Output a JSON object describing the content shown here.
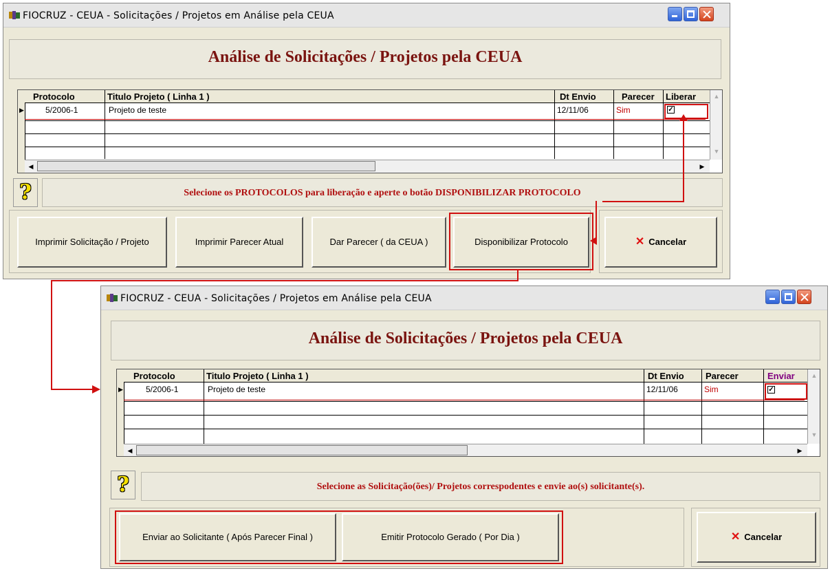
{
  "window_top": {
    "title": "FIOCRUZ - CEUA - Solicitações / Projetos em Análise pela CEUA",
    "heading": "Análise de Solicitações / Projetos pela CEUA",
    "columns": [
      "Protocolo",
      "Titulo Projeto ( Linha 1 )",
      "Dt Envio",
      "Parecer",
      "Liberar"
    ],
    "row": {
      "protocolo": "5/2006-1",
      "titulo": "Projeto de teste",
      "dt_envio": "12/11/06",
      "parecer": "Sim",
      "checked": true
    },
    "message": "Selecione os PROTOCOLOS para liberação e aperte o botão DISPONIBILIZAR PROTOCOLO",
    "buttons": {
      "imprimir_solicitacao": "Imprimir Solicitação / Projeto",
      "imprimir_parecer": "Imprimir Parecer Atual",
      "dar_parecer": "Dar Parecer  ( da CEUA )",
      "disponibilizar": "Disponibilizar Protocolo",
      "cancelar": "Cancelar"
    }
  },
  "window_bottom": {
    "title": "FIOCRUZ - CEUA - Solicitações / Projetos em Análise pela CEUA",
    "heading": "Análise de Solicitações / Projetos pela CEUA",
    "columns": [
      "Protocolo",
      "Titulo Projeto ( Linha 1 )",
      "Dt Envio",
      "Parecer",
      "Enviar"
    ],
    "row": {
      "protocolo": "5/2006-1",
      "titulo": "Projeto de teste",
      "dt_envio": "12/11/06",
      "parecer": "Sim",
      "checked": true
    },
    "message": "Selecione as Solicitação(ões)/ Projetos correspodentes e envie ao(s) solicitante(s).",
    "buttons": {
      "enviar_solicitante": "Enviar ao Solicitante ( Após Parecer Final )",
      "emitir_protocolo": "Emitir Protocolo Gerado ( Por Dia )",
      "cancelar": "Cancelar"
    }
  },
  "colors": {
    "heading": "#7a1410",
    "message": "#b01010",
    "annotation": "#d01010",
    "parecer_value": "#c00000",
    "enviar_header": "#800080"
  }
}
